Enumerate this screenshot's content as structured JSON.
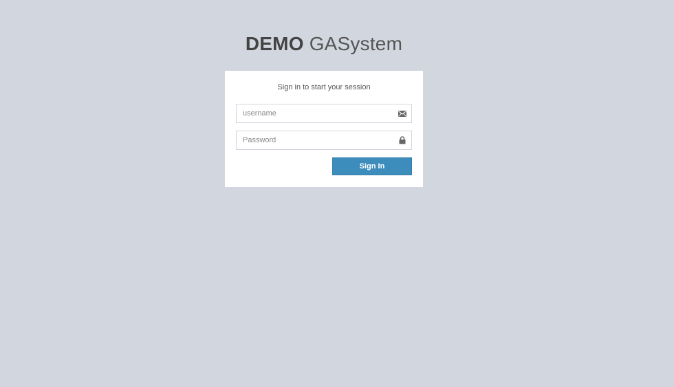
{
  "logo": {
    "bold": "DEMO",
    "light": "GASystem"
  },
  "form": {
    "message": "Sign in to start your session",
    "username": {
      "placeholder": "username",
      "value": "",
      "icon": "envelope-icon"
    },
    "password": {
      "placeholder": "Password",
      "value": "",
      "icon": "lock-icon"
    },
    "submit_label": "Sign In"
  },
  "colors": {
    "background": "#d2d6de",
    "primary": "#3c8dbc",
    "box": "#ffffff"
  }
}
